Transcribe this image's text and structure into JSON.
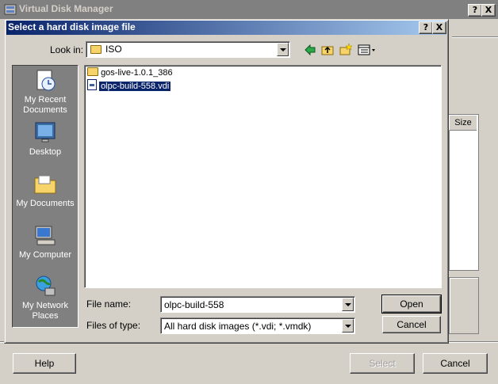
{
  "background_window": {
    "title": "Virtual Disk Manager",
    "title_buttons": {
      "help": "?",
      "close": "X"
    },
    "list_column_size": "Size",
    "buttons": {
      "help": "Help",
      "select": "Select",
      "cancel": "Cancel"
    }
  },
  "dialog": {
    "title": "Select a hard disk image file",
    "title_buttons": {
      "help": "?",
      "close": "X"
    },
    "look_in": {
      "label": "Look in:",
      "value": "ISO"
    },
    "toolbar": [
      "back-arrow-icon",
      "up-folder-icon",
      "new-folder-icon",
      "view-menu-icon"
    ],
    "places": [
      {
        "label": "My Recent Documents",
        "icon": "recent-documents-icon"
      },
      {
        "label": "Desktop",
        "icon": "desktop-icon"
      },
      {
        "label": "My Documents",
        "icon": "my-documents-icon"
      },
      {
        "label": "My Computer",
        "icon": "my-computer-icon"
      },
      {
        "label": "My Network Places",
        "icon": "network-places-icon"
      }
    ],
    "files": [
      {
        "name": "gos-live-1.0.1_386",
        "type": "folder",
        "selected": false
      },
      {
        "name": "olpc-build-558.vdi",
        "type": "vdi",
        "selected": true
      }
    ],
    "file_name": {
      "label": "File name:",
      "value": "olpc-build-558"
    },
    "file_type": {
      "label": "Files of type:",
      "value": "All hard disk images (*.vdi; *.vmdk)"
    },
    "buttons": {
      "open": "Open",
      "cancel": "Cancel"
    }
  }
}
